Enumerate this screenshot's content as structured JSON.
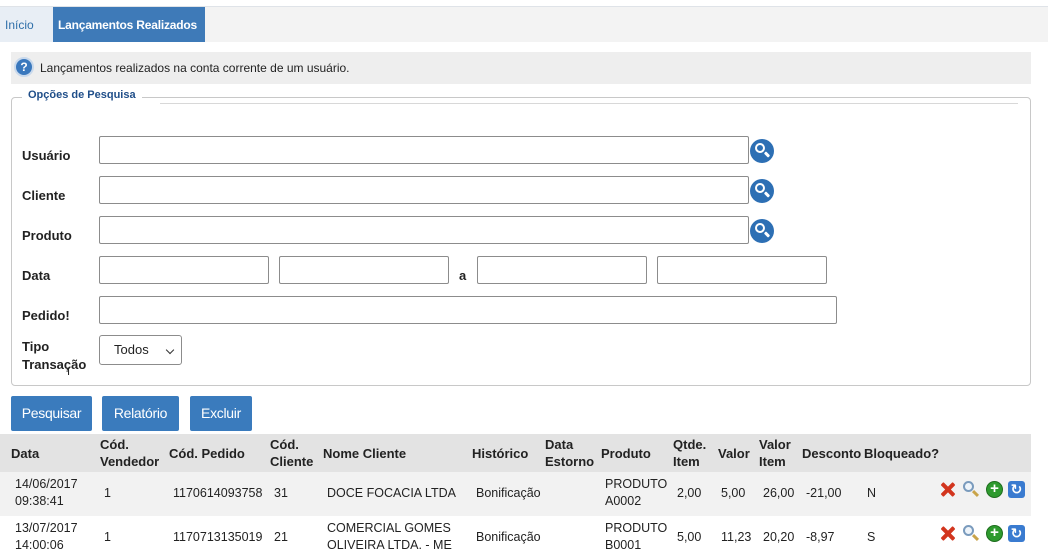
{
  "tabs": [
    {
      "label": "Início"
    },
    {
      "label": "Lançamentos Realizados"
    }
  ],
  "info": {
    "text": "Lançamentos realizados na conta corrente de um usuário."
  },
  "search_options": {
    "legend": "Opções de Pesquisa",
    "usuario_label": "Usuário",
    "cliente_label": "Cliente",
    "produto_label": "Produto",
    "data_label": "Data",
    "data_separator": "a",
    "pedido_label": "Pedido!",
    "tipo_label_1": "Tipo",
    "tipo_label_2": "Transação",
    "tipo_selected": "Todos",
    "usuario_value": "",
    "cliente_value": "",
    "produto_value": "",
    "data_from_1": "",
    "data_from_2": "",
    "data_to_1": "",
    "data_to_2": "",
    "pedido_value": ""
  },
  "buttons": {
    "pesquisar": "Pesquisar",
    "relatorio": "Relatório",
    "excluir": "Excluir"
  },
  "table": {
    "headers": {
      "data": "Data",
      "cod_vendedor_1": "Cód.",
      "cod_vendedor_2": "Vendedor",
      "cod_pedido": "Cód. Pedido",
      "cod_cliente_1": "Cód.",
      "cod_cliente_2": "Cliente",
      "nome_cliente": "Nome Cliente",
      "historico": "Histórico",
      "data_estorno_1": "Data",
      "data_estorno_2": "Estorno",
      "produto": "Produto",
      "qtde_item_1": "Qtde.",
      "qtde_item_2": "Item",
      "valor": "Valor",
      "valor_item_1": "Valor",
      "valor_item_2": "Item",
      "desconto": "Desconto",
      "bloqueado": "Bloqueado?"
    },
    "rows": [
      {
        "data_1": "14/06/2017",
        "data_2": "09:38:41",
        "cod_vendedor": "1",
        "cod_pedido": "1170614093758",
        "cod_cliente": "31",
        "nome_cliente_1": "DOCE FOCACIA LTDA",
        "nome_cliente_2": "",
        "historico": "Bonificação",
        "data_estorno": "",
        "produto_1": "PRODUTO",
        "produto_2": "A0002",
        "qtde_item": "2,00",
        "valor": "5,00",
        "valor_item": "26,00",
        "desconto": "-21,00",
        "bloqueado": "N"
      },
      {
        "data_1": "13/07/2017",
        "data_2": "14:00:06",
        "cod_vendedor": "1",
        "cod_pedido": "1170713135019",
        "cod_cliente": "21",
        "nome_cliente_1": "COMERCIAL GOMES",
        "nome_cliente_2": "OLIVEIRA LTDA. - ME",
        "historico": "Bonificação",
        "data_estorno": "",
        "produto_1": "PRODUTO",
        "produto_2": "B0001",
        "qtde_item": "5,00",
        "valor": "11,23",
        "valor_item": "20,20",
        "desconto": "-8,97",
        "bloqueado": "S"
      }
    ],
    "row_icons": [
      "delete-icon",
      "view-icon",
      "add-icon",
      "refresh-icon"
    ]
  },
  "colors": {
    "accent": "#3a7bbd",
    "tab_active": "#3e7ab8",
    "legend_text": "#1f4e89",
    "delete_red": "#d2351e",
    "add_green": "#2e9a2e"
  }
}
